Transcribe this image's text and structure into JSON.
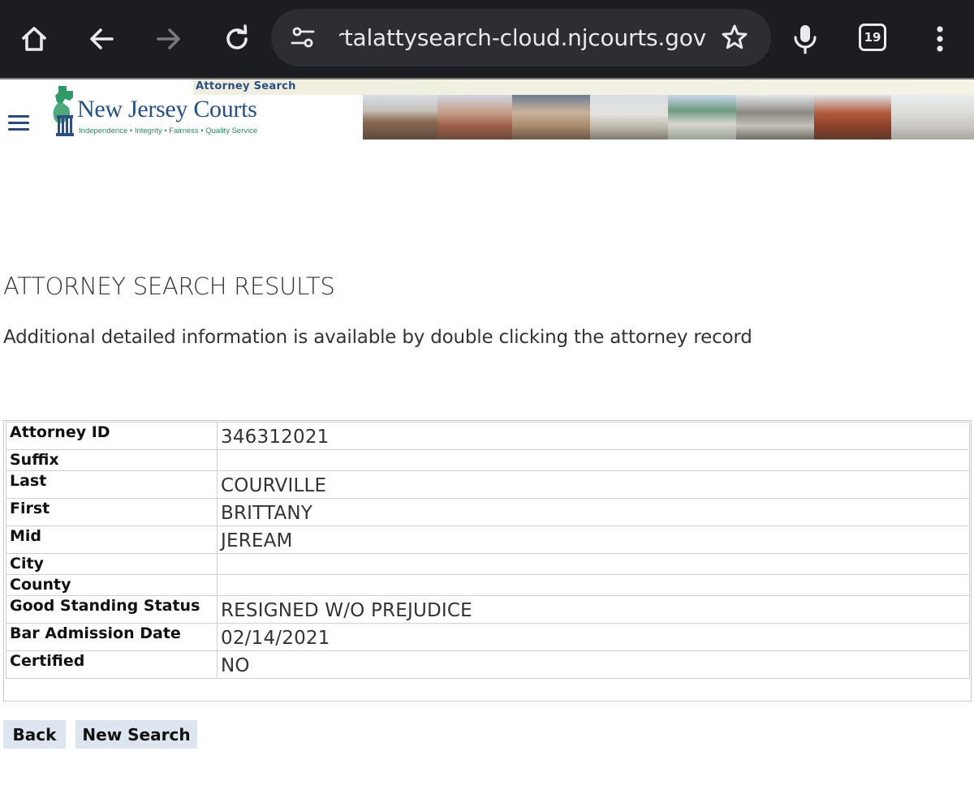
{
  "browser": {
    "url": "portalattysearch-cloud.njcourts.gov",
    "tab_count": "19"
  },
  "header": {
    "strip_label": "Attorney Search",
    "logo_title": "New Jersey Courts",
    "logo_tagline": "Independence • Integrity • Fairness • Quality Service"
  },
  "main": {
    "title": "ATTORNEY SEARCH RESULTS",
    "subtitle": "Additional detailed information is available by double clicking the attorney record"
  },
  "record": {
    "rows": [
      {
        "label": "Attorney ID",
        "value": "346312021"
      },
      {
        "label": "Suffix",
        "value": ""
      },
      {
        "label": "Last",
        "value": "COURVILLE"
      },
      {
        "label": "First",
        "value": "BRITTANY"
      },
      {
        "label": "Mid",
        "value": "JEREAM"
      },
      {
        "label": "City",
        "value": ""
      },
      {
        "label": "County",
        "value": ""
      },
      {
        "label": "Good Standing Status",
        "value": "RESIGNED W/O PREJUDICE"
      },
      {
        "label": "Bar Admission Date",
        "value": "02/14/2021"
      },
      {
        "label": "Certified",
        "value": "NO"
      }
    ]
  },
  "actions": {
    "back_label": "Back",
    "new_search_label": "New Search"
  },
  "icons": {
    "home": "home-icon",
    "back": "arrow-back-icon",
    "forward": "arrow-forward-icon",
    "reload": "reload-icon",
    "site_settings": "tune-icon",
    "bookmark": "star-icon",
    "voice": "mic-icon",
    "tabs": "tab-switcher-icon",
    "menu": "more-vert-icon"
  },
  "colors": {
    "chrome_bg": "#1c1d20",
    "urlbar_bg": "#2c2e33",
    "brand_blue": "#23508a",
    "brand_green": "#2a8a5a",
    "button_bg": "#dde6f0"
  }
}
